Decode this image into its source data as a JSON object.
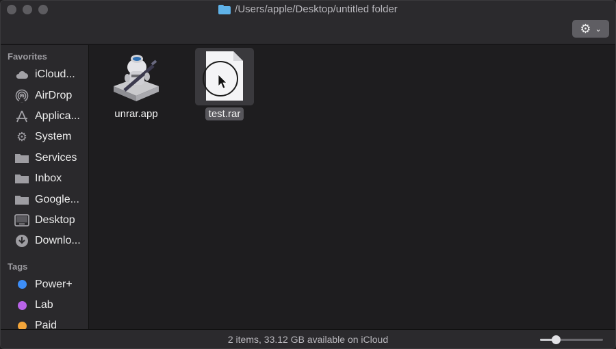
{
  "window": {
    "title": "/Users/apple/Desktop/untitled folder",
    "action_icon": "gear-icon"
  },
  "sidebar": {
    "favorites_title": "Favorites",
    "favorites": [
      {
        "label": "iCloud...",
        "icon": "cloud-icon"
      },
      {
        "label": "AirDrop",
        "icon": "airdrop-icon"
      },
      {
        "label": "Applica...",
        "icon": "applications-icon"
      },
      {
        "label": "System",
        "icon": "gear-icon"
      },
      {
        "label": "Services",
        "icon": "folder-icon"
      },
      {
        "label": "Inbox",
        "icon": "folder-icon"
      },
      {
        "label": "Google...",
        "icon": "folder-icon"
      },
      {
        "label": "Desktop",
        "icon": "desktop-icon"
      },
      {
        "label": "Downlo...",
        "icon": "download-icon"
      }
    ],
    "tags_title": "Tags",
    "tags": [
      {
        "label": "Power+",
        "color": "#3d8ef7"
      },
      {
        "label": "Lab",
        "color": "#b963e8"
      },
      {
        "label": "Paid",
        "color": "#f3a53a"
      }
    ]
  },
  "files": [
    {
      "name": "unrar.app",
      "icon": "automator-app-icon",
      "selected": false
    },
    {
      "name": "test.rar",
      "icon": "document-icon",
      "selected": true
    }
  ],
  "status": {
    "text": "2 items, 33.12 GB available on iCloud",
    "icon_size_fraction": 0.25
  }
}
